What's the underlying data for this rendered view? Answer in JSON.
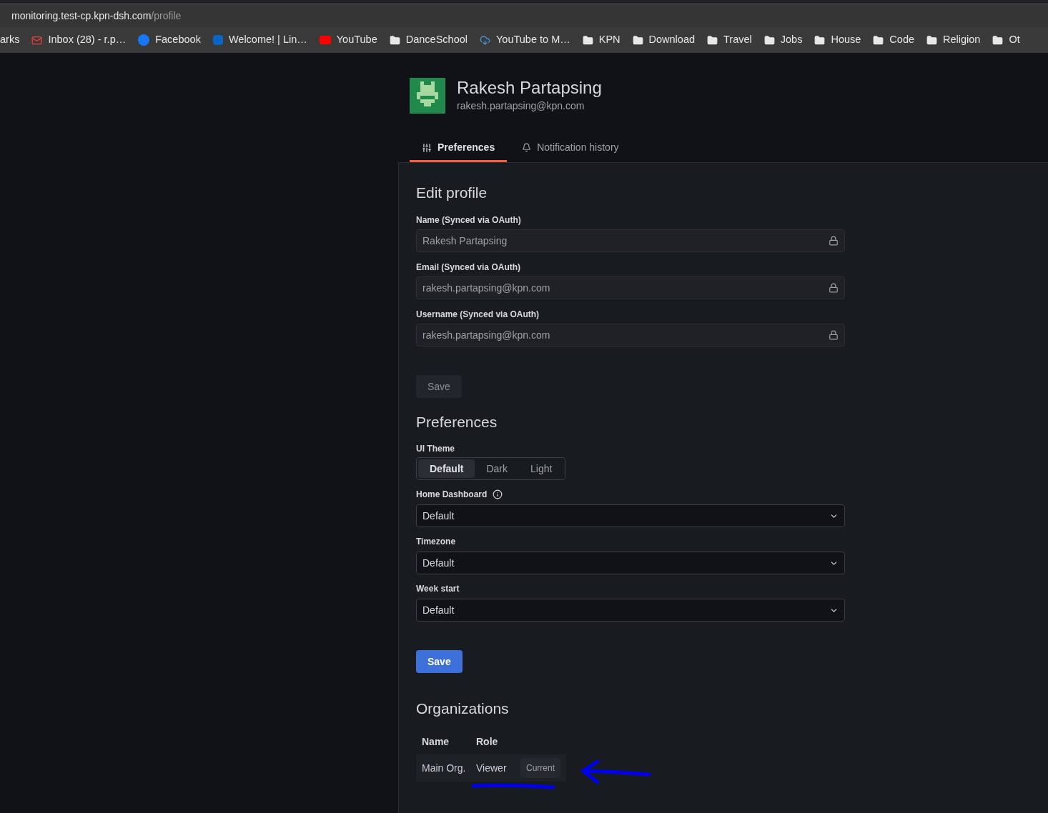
{
  "browser": {
    "url_host": "monitoring.test-cp.kpn-dsh.com",
    "url_path": "/profile",
    "bookmarks": [
      {
        "label": "arks",
        "kind": "text"
      },
      {
        "label": "Inbox (28) - r.p…",
        "kind": "mail"
      },
      {
        "label": "Facebook",
        "kind": "facebook"
      },
      {
        "label": "Welcome! | Lin…",
        "kind": "linkedin"
      },
      {
        "label": "YouTube",
        "kind": "youtube"
      },
      {
        "label": "DanceSchool",
        "kind": "folder"
      },
      {
        "label": "YouTube to M…",
        "kind": "cloud"
      },
      {
        "label": "KPN",
        "kind": "folder"
      },
      {
        "label": "Download",
        "kind": "folder"
      },
      {
        "label": "Travel",
        "kind": "folder"
      },
      {
        "label": "Jobs",
        "kind": "folder"
      },
      {
        "label": "House",
        "kind": "folder"
      },
      {
        "label": "Code",
        "kind": "folder"
      },
      {
        "label": "Religion",
        "kind": "folder"
      },
      {
        "label": "Ot",
        "kind": "folder"
      }
    ]
  },
  "profile": {
    "name": "Rakesh Partapsing",
    "email": "rakesh.partapsing@kpn.com"
  },
  "tabs": [
    {
      "label": "Preferences",
      "kind": "sliders",
      "selected": true
    },
    {
      "label": "Notification history",
      "kind": "bell",
      "selected": false
    }
  ],
  "edit_profile": {
    "title": "Edit profile",
    "fields": [
      {
        "label": "Name (Synced via OAuth)",
        "value": "Rakesh Partapsing",
        "disabled": true
      },
      {
        "label": "Email (Synced via OAuth)",
        "value": "rakesh.partapsing@kpn.com",
        "disabled": true
      },
      {
        "label": "Username (Synced via OAuth)",
        "value": "rakesh.partapsing@kpn.com",
        "disabled": true
      }
    ],
    "save": {
      "label": "Save",
      "disabled": true
    }
  },
  "preferences": {
    "title": "Preferences",
    "theme_label": "UI Theme",
    "theme_options": [
      {
        "label": "Default",
        "selected": true
      },
      {
        "label": "Dark",
        "selected": false
      },
      {
        "label": "Light",
        "selected": false
      }
    ],
    "selects": [
      {
        "label": "Home Dashboard",
        "info": true,
        "value": "Default"
      },
      {
        "label": "Timezone",
        "value": "Default"
      },
      {
        "label": "Week start",
        "value": "Default"
      }
    ],
    "save": {
      "label": "Save",
      "disabled": false
    }
  },
  "organizations": {
    "title": "Organizations",
    "columns": [
      "Name",
      "Role"
    ],
    "rows": [
      {
        "name": "Main Org.",
        "role": "Viewer",
        "badge": "Current"
      }
    ]
  }
}
